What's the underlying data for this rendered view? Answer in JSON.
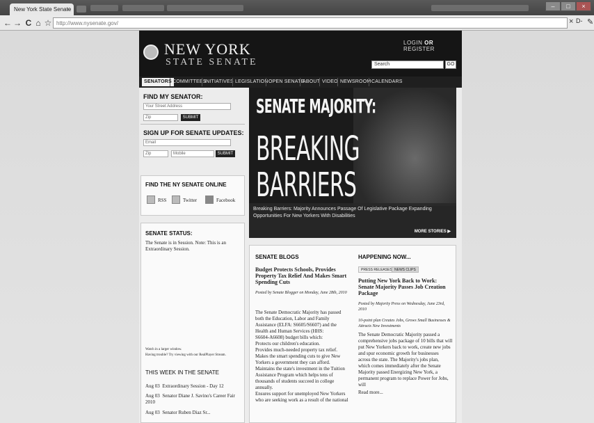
{
  "browser": {
    "tab_title": "New York State Senate",
    "tab_close": "×",
    "url": "http://www.nysenate.gov/",
    "back": "←",
    "forward": "→",
    "reload": "C",
    "home": "⌂",
    "star": "☆",
    "close_x": "×",
    "page_menu": "D-",
    "wrench": "✎"
  },
  "header": {
    "logo_line1": "NEW YORK",
    "logo_line2": "STATE SENATE",
    "login": "LOGIN",
    "or": "OR",
    "register": "REGISTER",
    "search_placeholder": "Search",
    "go": "GO"
  },
  "nav": [
    "SENATORS",
    "COMMITTEES",
    "INITIATIVES",
    "LEGISLATION",
    "OPEN SENATE",
    "ABOUT",
    "VIDEO",
    "NEWSROOM",
    "CALENDARS"
  ],
  "find_senator": {
    "title": "FIND MY SENATOR:",
    "street_placeholder": "Your Street Address",
    "zip_placeholder": "Zip",
    "submit": "SUBMIT"
  },
  "signup": {
    "title": "SIGN UP FOR SENATE UPDATES:",
    "email_placeholder": "Email",
    "zip_placeholder": "Zip",
    "mobile_placeholder": "Mobile",
    "submit": "SUBMIT"
  },
  "online": {
    "title": "FIND THE NY SENATE ONLINE",
    "rss": "RSS",
    "twitter": "Twitter",
    "facebook": "Facebook"
  },
  "status": {
    "title": "SENATE STATUS:",
    "text": "The Senate is in Session. Note: This is an Extraordinary Session.",
    "watch1": "Watch in a larger window.",
    "watch2": "Having trouble? Try viewing with our RealPlayer Stream."
  },
  "week": {
    "title": "THIS WEEK IN THE SENATE",
    "items": [
      {
        "date": "Aug 03",
        "text": "Extraordinary Session - Day 12"
      },
      {
        "date": "Aug 03",
        "text": "Senator Diane J. Savino's Career Fair 2010"
      },
      {
        "date": "Aug 03",
        "text": "Senator Ruben Diaz Sr..."
      }
    ]
  },
  "hero": {
    "line1": "SENATE MAJORITY:",
    "line2": "BREAKING",
    "line3": "BARRIERS",
    "caption": "Breaking Barriers: Majority Announces Passage Of Legislative Package Expanding Opportunities For New Yorkers With Disabilities",
    "more": "MORE STORIES ▶"
  },
  "blogs": {
    "title": "SENATE BLOGS",
    "headline": "Budget Protects Schools, Provides Property Tax Relief And Makes Smart Spending Cuts",
    "byline": "Posted by Senate Blogger on Monday, June 28th, 2010",
    "body": [
      "The Senate Democratic Majority has passed",
      "both the Education, Labor and Family",
      "Assistance (ELFA: S6605/S6607) and the",
      "Health and Human Services (HHS:",
      "S6604-A6608) budget bills which:",
      "Protects our children's education.",
      "Provides much-needed property tax relief.",
      "Makes the smart spending cuts to give New",
      "Yorkers a government they can afford.",
      "Maintains the state's investment in the Tuition",
      "Assistance Program which helps tens of",
      "thousands of students succeed in college",
      "annually.",
      "Ensures support for unemployed New Yorkers",
      "who are seeking work as a result of the national"
    ]
  },
  "happening": {
    "title": "HAPPENING NOW...",
    "tab1": "PRESS RELEASES",
    "tab2": "NEWS CLIPS",
    "headline": "Putting New York Back to Work: Senate Majority Passes Job Creation Package",
    "byline": "Posted by Majority Press on Wednesday, June 23rd, 2010",
    "sub": "10-point plan Creates Jobs, Grows Small Businesses & Attracts New Investments",
    "body": [
      "The Senate Democratic Majority passed a",
      "comprehensive jobs package of 10 bills that will",
      "put New Yorkers back to work, create new jobs",
      "and spur economic growth for businesses",
      "across the state. The Majority's jobs plan,",
      "which comes immediately after the Senate",
      "Majority passed Energizing New York, a",
      "permanent program to replace Power for Jobs,",
      "will"
    ],
    "read_more": "Read more..."
  }
}
